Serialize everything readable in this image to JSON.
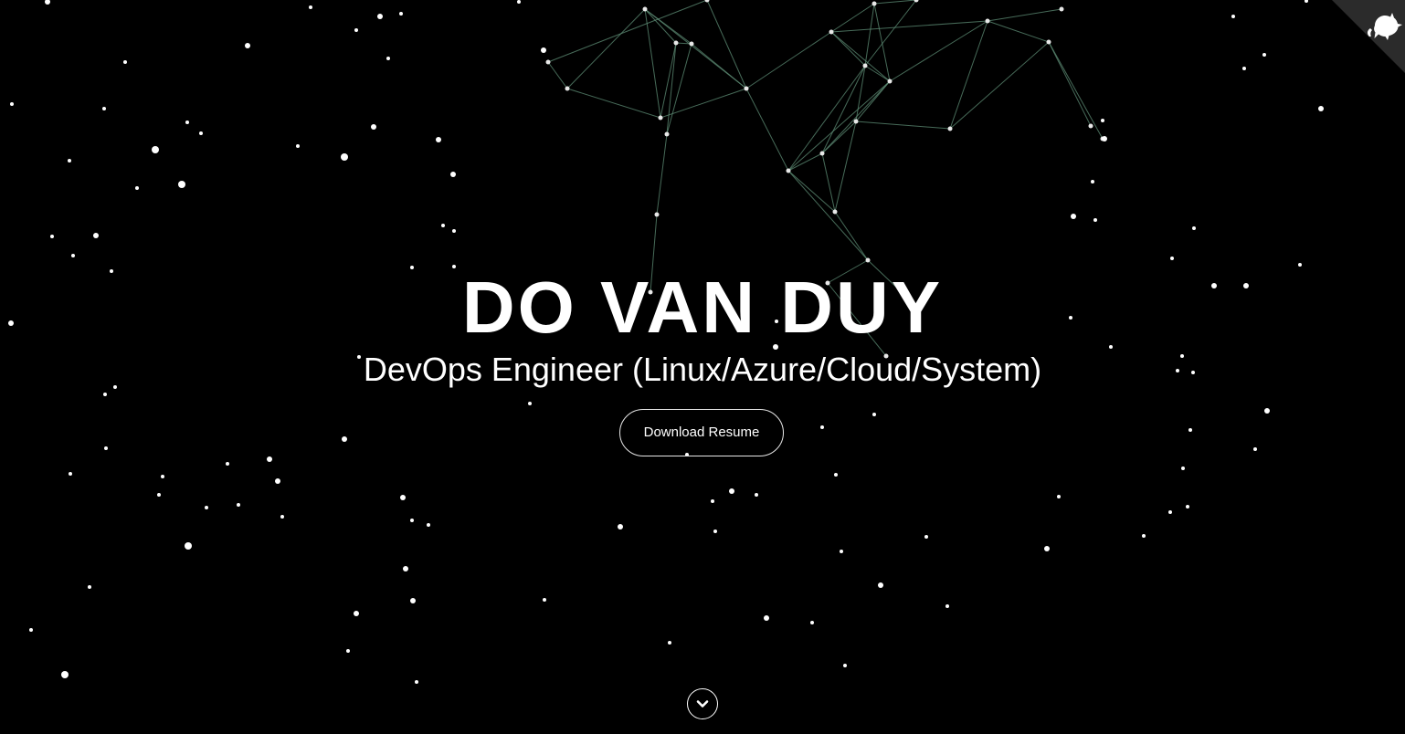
{
  "hero": {
    "name": "DO VAN DUY",
    "subtitle": "DevOps Engineer (Linux/Azure/Cloud/System)",
    "resume_button_label": "Download Resume"
  },
  "icons": {
    "corner": "github-cat-icon",
    "scroll": "chevron-down-icon"
  },
  "colors": {
    "background": "#000000",
    "text": "#ffffff",
    "network_lines": "#5f8f77",
    "stars": "#ffffff",
    "corner_badge": "#2b2b2b"
  }
}
